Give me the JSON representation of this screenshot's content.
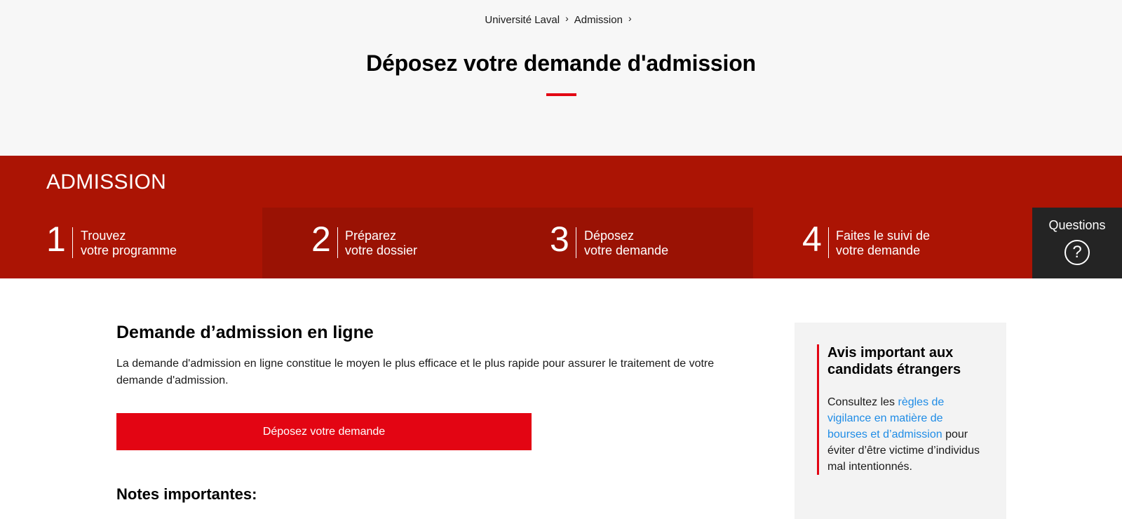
{
  "breadcrumb": {
    "items": [
      "Université Laval",
      "Admission"
    ]
  },
  "page": {
    "title": "Déposez votre demande d'admission"
  },
  "admission_band": {
    "title": "ADMISSION",
    "steps": [
      {
        "number": "1",
        "line1": "Trouvez",
        "line2": "votre programme",
        "active": false
      },
      {
        "number": "2",
        "line1": "Préparez",
        "line2": "votre dossier",
        "active": true
      },
      {
        "number": "3",
        "line1": "Déposez",
        "line2": "votre demande",
        "active": true
      },
      {
        "number": "4",
        "line1": "Faites le suivi de",
        "line2": "votre demande",
        "active": false
      }
    ],
    "questions_label": "Questions"
  },
  "content": {
    "heading": "Demande d’admission en ligne",
    "intro": "La demande d'admission en ligne constitue le moyen le plus efficace et le plus rapide pour assurer le traitement de votre demande d'admission.",
    "cta_label": "Déposez votre demande",
    "notes_heading": "Notes importantes:"
  },
  "notice": {
    "title": "Avis important aux candidats étrangers",
    "text_before": "Consultez les ",
    "link_text": "règles de vigilance en matière de bourses et d’admission",
    "text_after": " pour éviter d’être victime d’individus mal intentionnés."
  },
  "colors": {
    "brand_red": "#ab1404",
    "accent_red": "#e30513",
    "link_blue": "#1f8ce6",
    "dark": "#242424"
  }
}
